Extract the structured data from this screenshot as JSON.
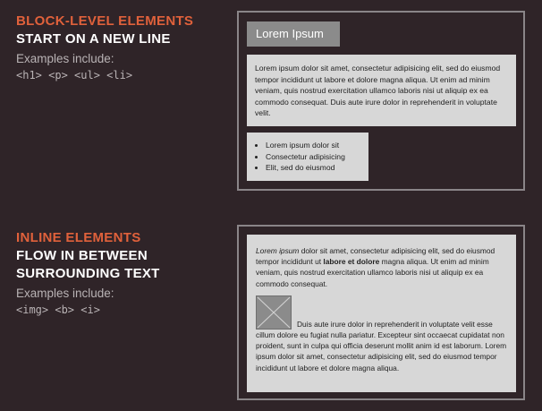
{
  "block": {
    "kicker": "BLOCK-LEVEL ELEMENTS",
    "heading": "START ON A NEW LINE",
    "examples_label": "Examples include:",
    "examples_code": "<h1> <p> <ul> <li>",
    "h1_text": "Lorem Ipsum",
    "paragraph": "Lorem ipsum dolor sit amet, consectetur adipisicing elit, sed do eiusmod tempor incididunt ut labore et dolore magna aliqua. Ut enim ad minim veniam, quis nostrud exercitation ullamco laboris nisi ut aliquip ex ea commodo consequat. Duis aute irure dolor in reprehenderit in voluptate velit.",
    "list_items": [
      "Lorem ipsum dolor sit",
      "Consectetur adipisicing",
      "Elit, sed do eiusmod"
    ]
  },
  "inline": {
    "kicker": "INLINE ELEMENTS",
    "heading_line1": "FLOW IN BETWEEN",
    "heading_line2": "SURROUNDING TEXT",
    "examples_label": "Examples include:",
    "examples_code": "<img> <b> <i>",
    "p1_italic": "Lorem ipsum",
    "p1_part1": " dolor sit amet, consectetur adipisicing elit, sed do eiusmod tempor incididunt ut ",
    "p1_bold": "labore et dolore",
    "p1_part2": " magna aliqua. Ut enim ad minim veniam, quis nostrud exercitation ullamco laboris nisi ut aliquip ex ea commodo consequat.",
    "p2": "Duis aute irure dolor in reprehenderit in voluptate velit esse cillum dolore eu fugiat nulla pariatur. Excepteur sint occaecat cupidatat non proident, sunt in culpa qui officia deserunt mollit anim id est laborum. Lorem ipsum dolor sit amet, consectetur adipisicing elit, sed do eiusmod tempor incididunt ut labore et dolore magna aliqua."
  },
  "colors": {
    "background": "#2f2428",
    "accent": "#e0613b",
    "box": "#d7d7d7",
    "placeholder": "#8b8b8b"
  }
}
